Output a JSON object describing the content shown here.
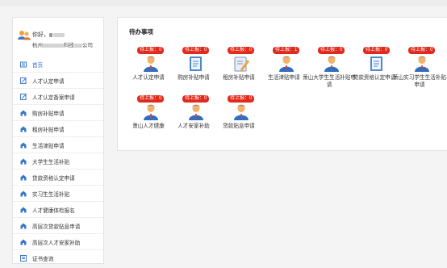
{
  "user": {
    "greeting": "你好，",
    "company_prefix": "杭州",
    "company_suffix": "科技",
    "company_end": "公司"
  },
  "menu": [
    {
      "label": "首页",
      "icon": "home-icon",
      "active": true
    },
    {
      "label": "人才认定申请",
      "icon": "edit-icon"
    },
    {
      "label": "人才认定备案申请",
      "icon": "edit-icon"
    },
    {
      "label": "购房补贴申请",
      "icon": "house-icon"
    },
    {
      "label": "租房补贴申请",
      "icon": "house-icon"
    },
    {
      "label": "生活津贴申请",
      "icon": "house-icon"
    },
    {
      "label": "大学生生活补贴",
      "icon": "house-icon"
    },
    {
      "label": "贷款资格认定申请",
      "icon": "house-icon"
    },
    {
      "label": "实习生生活补贴",
      "icon": "house-icon"
    },
    {
      "label": "人才健康体检报名",
      "icon": "house-icon"
    },
    {
      "label": "高层次贷款贴息申请",
      "icon": "house-icon"
    },
    {
      "label": "高层次人才安家补助",
      "icon": "house-icon"
    },
    {
      "label": "证书查询",
      "icon": "certificate-icon"
    }
  ],
  "panel": {
    "title": "待办事项"
  },
  "tasks": [
    {
      "badge": "待上报：0",
      "label": "人才认定申请",
      "icon": "person-icon"
    },
    {
      "badge": "待上报：0",
      "label": "购房补贴申请",
      "icon": "document-icon"
    },
    {
      "badge": "待上报：0",
      "label": "租房补贴申请",
      "icon": "edit-document-icon"
    },
    {
      "badge": "待上报：1",
      "label": "生活津贴申请",
      "icon": "person-icon"
    },
    {
      "badge": "待上报：0",
      "label": "萧山大学生生活补贴申请",
      "icon": "person-icon"
    },
    {
      "badge": "待上报：0",
      "label": "贷款资格认定申请",
      "icon": "document-icon"
    },
    {
      "badge": "待上报：0",
      "label": "萧山实习学生生活补贴申请",
      "icon": "person-icon"
    },
    {
      "badge": "待上报：0",
      "label": "萧山人才健康",
      "icon": "person-icon"
    },
    {
      "badge": "待上报：0",
      "label": "人才安家补助",
      "icon": "person-icon"
    },
    {
      "badge": "待上报：0",
      "label": "贷款贴息申请",
      "icon": "person-icon"
    }
  ],
  "colors": {
    "accent": "#2f6cc6",
    "badge": "#e12a1c",
    "icon_blue": "#2d6fc0",
    "icon_orange": "#f0a03a"
  }
}
